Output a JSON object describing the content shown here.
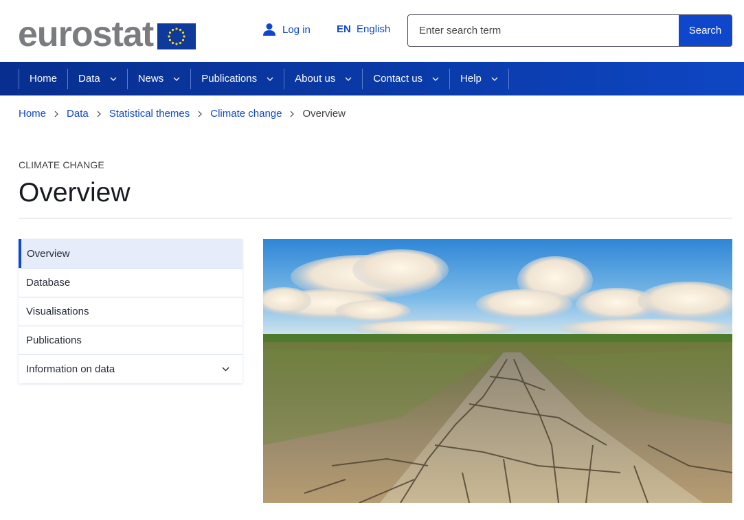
{
  "header": {
    "logo_text": "eurostat",
    "login_label": "Log in",
    "language_code": "EN",
    "language_label": "English",
    "search": {
      "placeholder": "Enter search term",
      "value": "",
      "button_label": "Search"
    }
  },
  "nav": {
    "items": [
      {
        "label": "Home",
        "has_dropdown": false
      },
      {
        "label": "Data",
        "has_dropdown": true
      },
      {
        "label": "News",
        "has_dropdown": true
      },
      {
        "label": "Publications",
        "has_dropdown": true
      },
      {
        "label": "About us",
        "has_dropdown": true
      },
      {
        "label": "Contact us",
        "has_dropdown": true
      },
      {
        "label": "Help",
        "has_dropdown": true
      }
    ]
  },
  "breadcrumb": [
    {
      "label": "Home"
    },
    {
      "label": "Data"
    },
    {
      "label": "Statistical themes"
    },
    {
      "label": "Climate change"
    },
    {
      "label": "Overview"
    }
  ],
  "page": {
    "kicker": "CLIMATE CHANGE",
    "title": "Overview"
  },
  "sidenav": {
    "items": [
      {
        "label": "Overview",
        "active": true
      },
      {
        "label": "Database"
      },
      {
        "label": "Visualisations"
      },
      {
        "label": "Publications"
      },
      {
        "label": "Information on data",
        "has_dropdown": true
      }
    ]
  },
  "hero": {
    "description": "Cracked dry soil under a blue sky with clouds"
  },
  "colors": {
    "brand_blue": "#0e47cb",
    "nav_dark": "#082f8f",
    "logo_grey": "#7b7c80",
    "eu_flag_blue": "#0e3b9b",
    "eu_star_yellow": "#ffd617"
  }
}
